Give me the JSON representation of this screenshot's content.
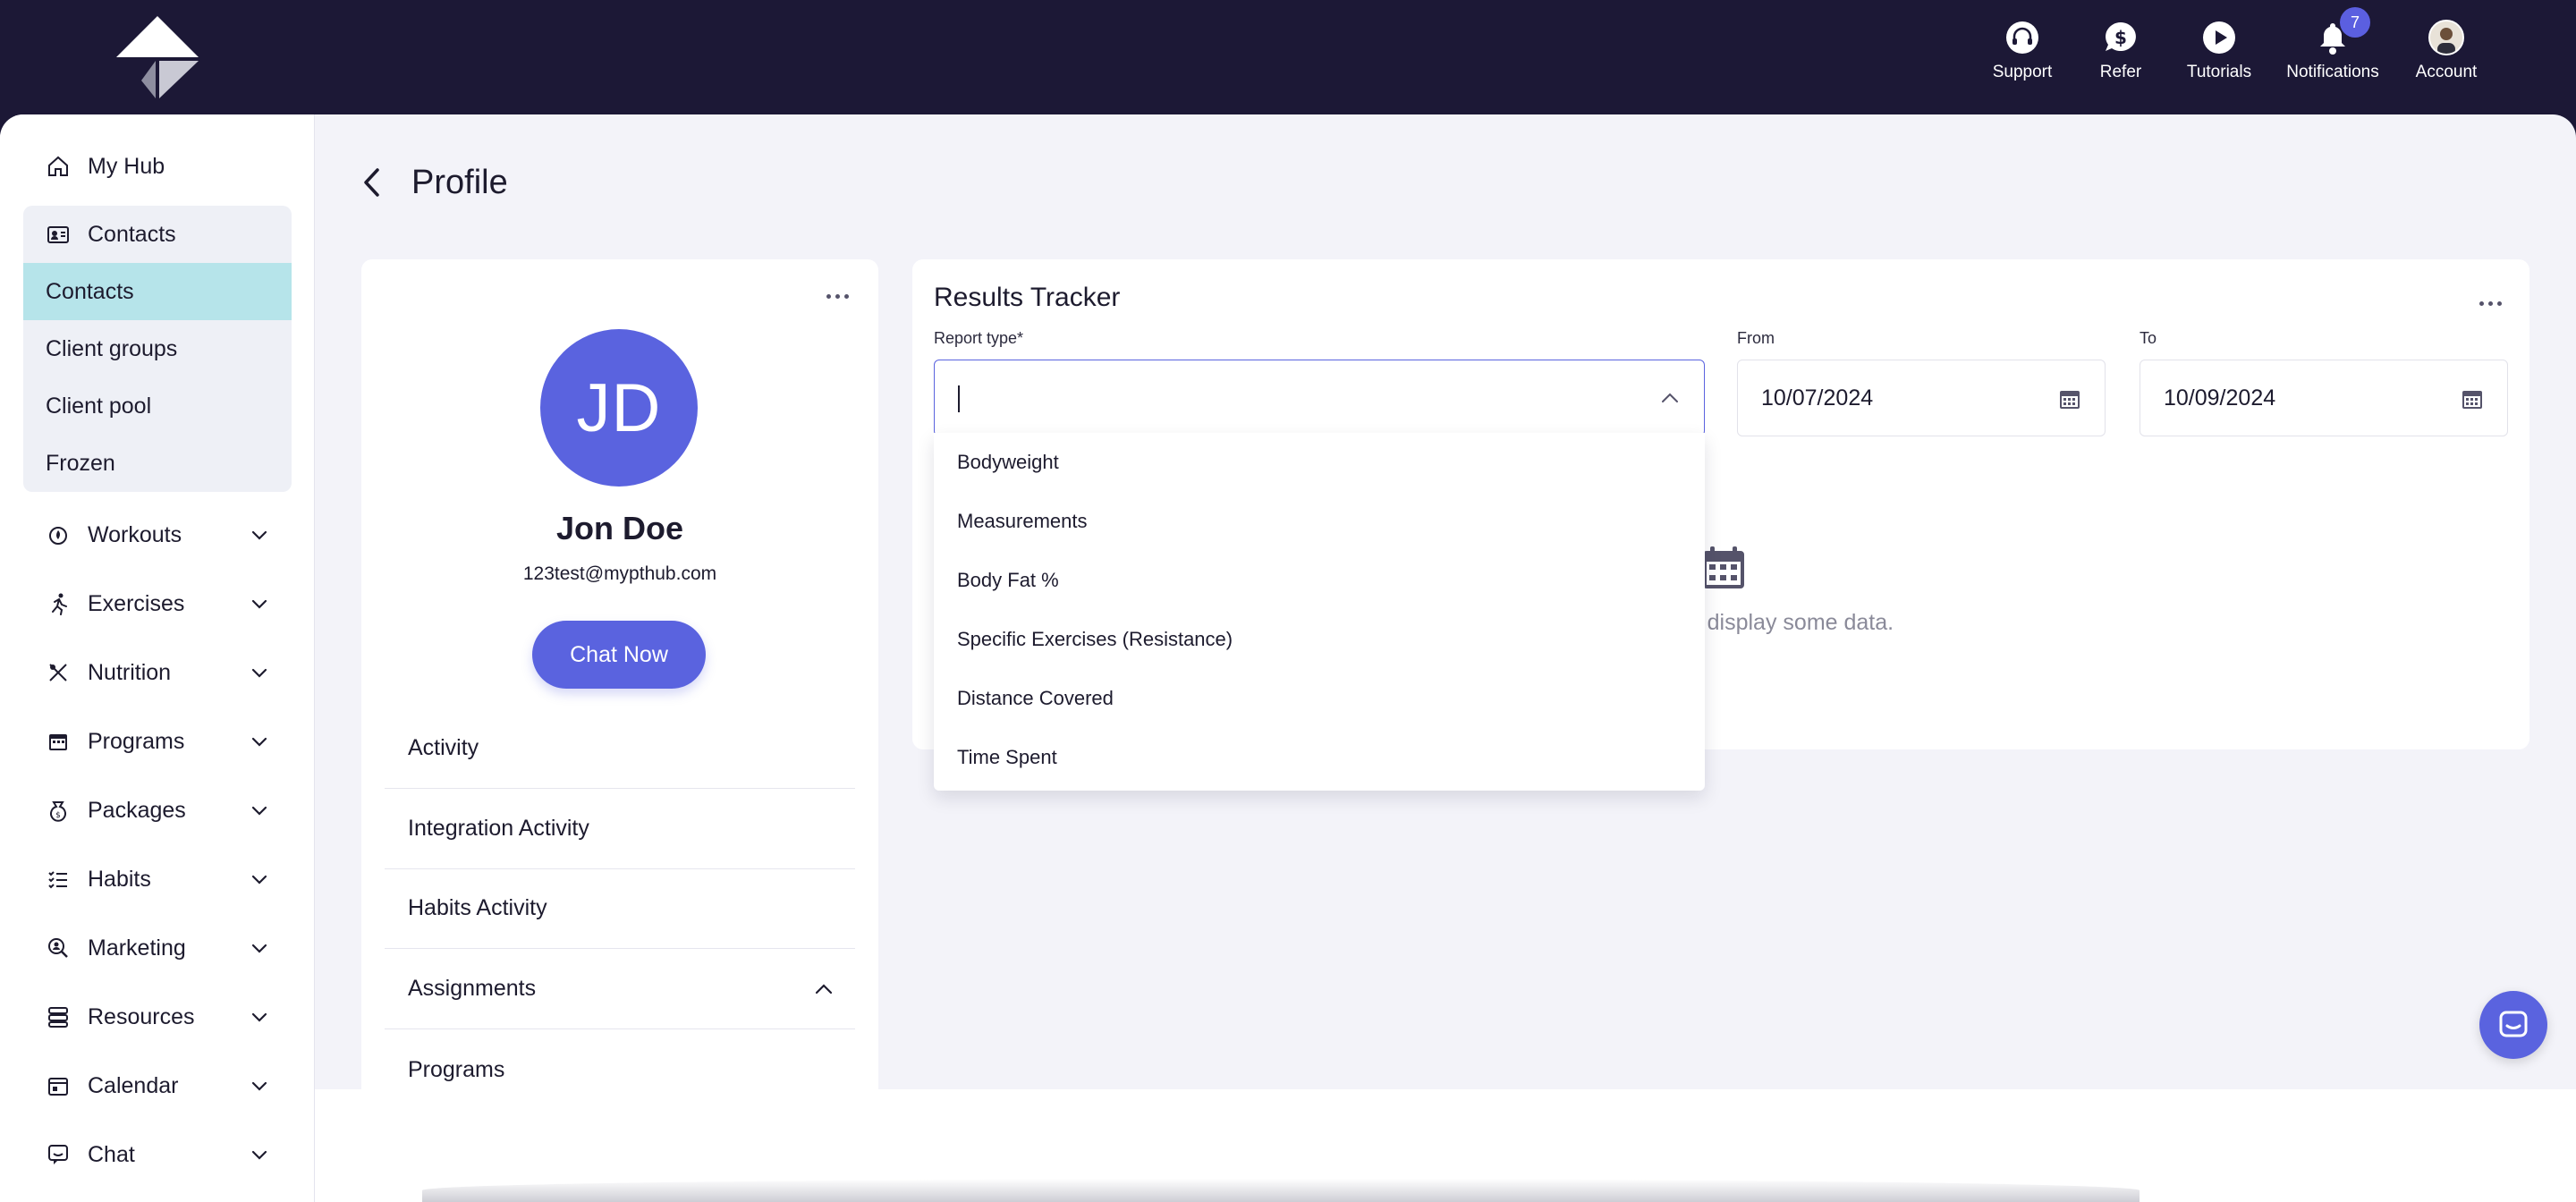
{
  "topbar": {
    "items": [
      {
        "label": "Support",
        "icon": "headset-icon"
      },
      {
        "label": "Refer",
        "icon": "dollar-chat-icon"
      },
      {
        "label": "Tutorials",
        "icon": "play-icon"
      },
      {
        "label": "Notifications",
        "icon": "bell-icon",
        "badge": "7"
      },
      {
        "label": "Account",
        "icon": "avatar"
      }
    ]
  },
  "sidebar": {
    "my_hub": "My Hub",
    "contacts_header": "Contacts",
    "contacts_sub": [
      "Contacts",
      "Client groups",
      "Client pool",
      "Frozen"
    ],
    "active_sub": "Contacts",
    "sections": [
      "Workouts",
      "Exercises",
      "Nutrition",
      "Programs",
      "Packages",
      "Habits",
      "Marketing",
      "Resources",
      "Calendar",
      "Chat"
    ]
  },
  "page": {
    "title": "Profile"
  },
  "profile": {
    "initials": "JD",
    "name": "Jon Doe",
    "email": "123test@mypthub.com",
    "chat_button": "Chat Now",
    "menu": [
      "Activity",
      "Integration Activity",
      "Habits Activity",
      "Assignments",
      "Programs"
    ]
  },
  "tracker": {
    "title": "Results Tracker",
    "report_type_label": "Report type*",
    "report_type_value": "",
    "from_label": "From",
    "from_value": "10/07/2024",
    "to_label": "To",
    "to_value": "10/09/2024",
    "empty_message": "e to display some data.",
    "options": [
      "Bodyweight",
      "Measurements",
      "Body Fat %",
      "Specific Exercises (Resistance)",
      "Distance Covered",
      "Time Spent"
    ]
  },
  "colors": {
    "topbar": "#1c1836",
    "accent": "#5a63df",
    "active_sub": "#b6e4ea",
    "background": "#f3f3f9"
  }
}
